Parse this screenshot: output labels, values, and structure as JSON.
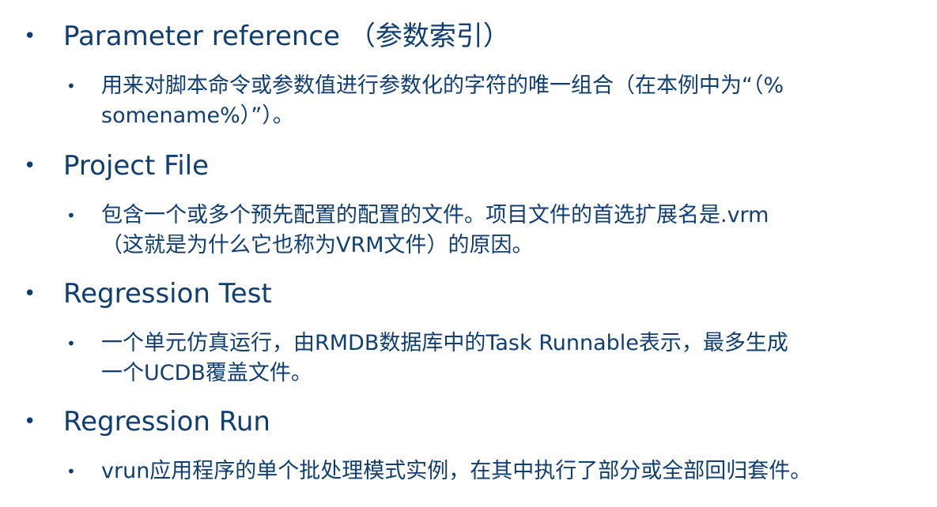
{
  "bullet_glyph": "•",
  "sub_bullet_glyph": "•",
  "entries": [
    {
      "term": "Parameter reference （参数索引）",
      "definition_lines": [
        "用来对脚本命令或参数值进行参数化的字符的唯一组合（在本例中为“（%",
        "somename%）”）。"
      ]
    },
    {
      "term": "Project File",
      "definition_lines": [
        "包含一个或多个预先配置的配置的文件。项目文件的首选扩展名是.vrm",
        "（这就是为什么它也称为VRM文件）的原因。"
      ]
    },
    {
      "term": "Regression Test",
      "definition_lines": [
        "一个单元仿真运行，由RMDB数据库中的Task Runnable表示，最多生成",
        "一个UCDB覆盖文件。"
      ]
    },
    {
      "term": "Regression Run",
      "definition_lines": [
        "vrun应用程序的单个批处理模式实例，在其中执行了部分或全部回归套件。"
      ]
    }
  ]
}
